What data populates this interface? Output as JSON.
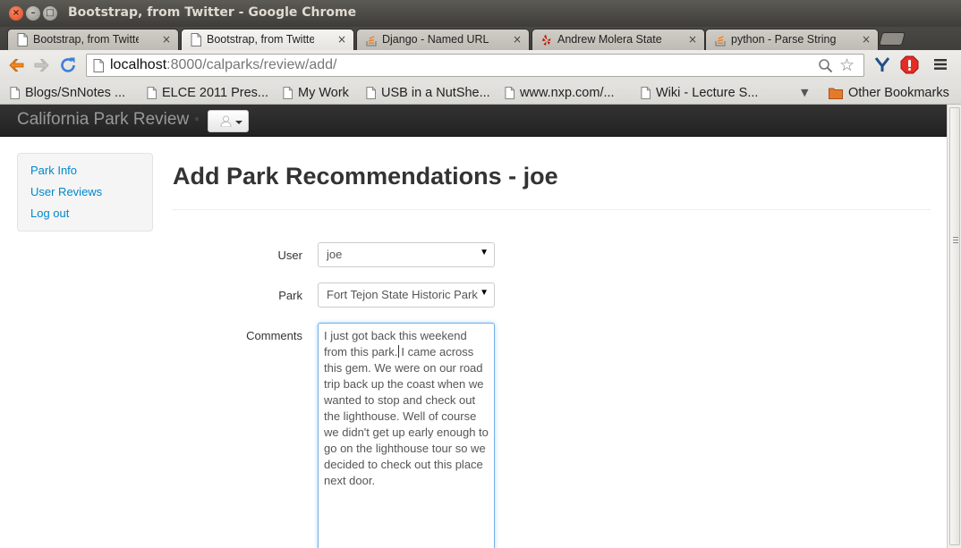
{
  "window": {
    "title": "Bootstrap, from Twitter - Google Chrome"
  },
  "tabs": [
    {
      "label": "Bootstrap, from Twitter",
      "close": "×",
      "active": false
    },
    {
      "label": "Bootstrap, from Twitter",
      "close": "×",
      "active": true
    },
    {
      "label": "Django - Named URLs not",
      "close": "×",
      "active": false
    },
    {
      "label": "Andrew Molera State Park",
      "close": "×",
      "active": false
    },
    {
      "label": "python - Parse String to F",
      "close": "×",
      "active": false
    }
  ],
  "address": {
    "host": "localhost",
    "rest": ":8000/calparks/review/add/"
  },
  "bookmarks": [
    {
      "label": "Blogs/SnNotes ..."
    },
    {
      "label": "ELCE 2011 Pres..."
    },
    {
      "label": "My Work"
    },
    {
      "label": "USB in a NutShe..."
    },
    {
      "label": "www.nxp.com/..."
    },
    {
      "label": "Wiki - Lecture S..."
    }
  ],
  "other_bookmarks": "Other Bookmarks",
  "navbar": {
    "brand": "California Park Review"
  },
  "sidebar": {
    "links": [
      {
        "label": "Park Info"
      },
      {
        "label": "User Reviews"
      },
      {
        "label": "Log out"
      }
    ]
  },
  "page": {
    "title": "Add Park Recommendations - joe"
  },
  "form": {
    "user_label": "User",
    "user_value": "joe",
    "park_label": "Park",
    "park_value": "Fort Tejon State Historic Park",
    "comments_label": "Comments",
    "comments_before_caret": "I just got back this weekend from this park.",
    "comments_after_caret": "I came across this gem. We were on our road trip back up the coast when we wanted to stop and check out the lighthouse. Well of course we didn't get up early enough to go on the lighthouse tour so we decided to check out this place next door."
  },
  "colors": {
    "link": "#0088cc",
    "navbar": "#222222",
    "focus": "#52a8ec"
  }
}
